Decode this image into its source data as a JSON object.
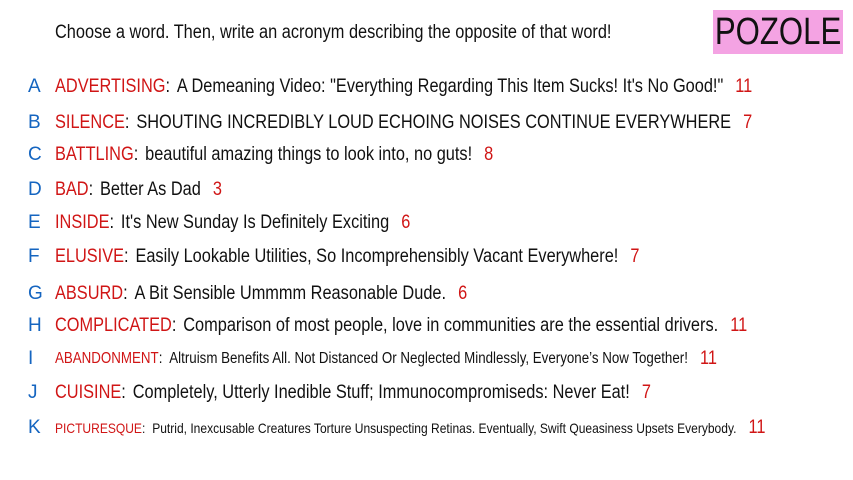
{
  "prompt": "Choose a word. Then, write an acronym describing the opposite of that word!",
  "badge": "POZOLE",
  "colors": {
    "letter": "#1565c0",
    "word": "#d01515",
    "count": "#d01515",
    "text": "#111111",
    "badge_bg": "#f4a3e3"
  },
  "entries": [
    {
      "letter": "A",
      "word": "ADVERTISING",
      "acronym": "A Demeaning Video: \"Everything Regarding This Item Sucks! It's No Good!\"",
      "count": "11"
    },
    {
      "letter": "B",
      "word": "SILENCE",
      "acronym": "SHOUTING INCREDIBLY LOUD ECHOING NOISES CONTINUE EVERYWHERE",
      "count": "7"
    },
    {
      "letter": "C",
      "word": "BATTLING",
      "acronym": "beautiful amazing things to look into, no guts!",
      "count": "8"
    },
    {
      "letter": "D",
      "word": "BAD",
      "acronym": "Better As Dad",
      "count": "3"
    },
    {
      "letter": "E",
      "word": "INSIDE",
      "acronym": "It's New Sunday Is Definitely Exciting",
      "count": "6"
    },
    {
      "letter": "F",
      "word": "ELUSIVE",
      "acronym": "Easily Lookable Utilities, So Incomprehensibly Vacant Everywhere!",
      "count": "7"
    },
    {
      "letter": "G",
      "word": "ABSURD",
      "acronym": "A Bit Sensible Ummmm Reasonable Dude.",
      "count": "6"
    },
    {
      "letter": "H",
      "word": "COMPLICATED",
      "acronym": "Comparison of most people, love in communities are the essential drivers.",
      "count": "11"
    },
    {
      "letter": "I",
      "word": "ABANDONMENT",
      "acronym": "Altruism Benefits All. Not Distanced Or Neglected Mindlessly, Everyone’s Now Together!",
      "count": "11"
    },
    {
      "letter": "J",
      "word": "CUISINE",
      "acronym": "Completely, Utterly Inedible Stuff; Immunocompromiseds: Never Eat!",
      "count": "7"
    },
    {
      "letter": "K",
      "word": "PICTURESQUE",
      "acronym": "Putrid, Inexcusable Creatures Torture Unsuspecting Retinas. Eventually, Swift Queasiness Upsets Everybody.",
      "count": "11"
    }
  ]
}
